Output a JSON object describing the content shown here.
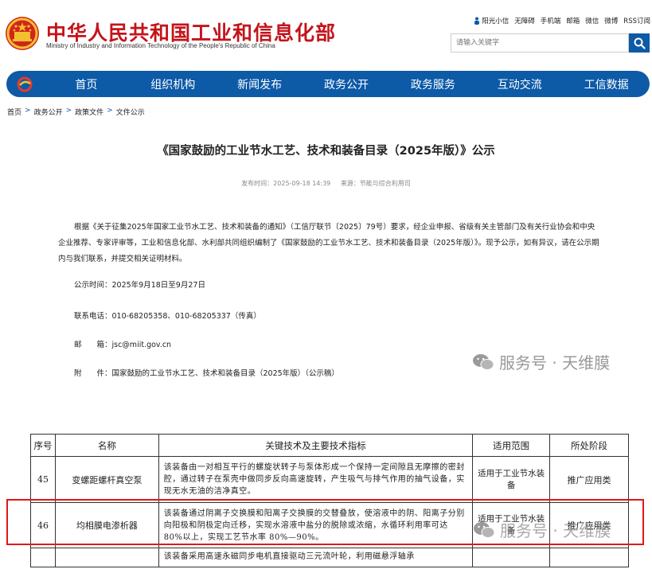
{
  "header": {
    "title": "中华人民共和国工业和信息化部",
    "subtitle": "Ministry of Industry and Information Technology of the People's Republic of China",
    "links": [
      "阳光小信",
      "无障碍",
      "手机端",
      "邮箱",
      "微信",
      "微博",
      "RSS订阅"
    ],
    "search_placeholder": "请输入关键字"
  },
  "nav": [
    "首页",
    "组织机构",
    "新闻发布",
    "政务公开",
    "政务服务",
    "互动交流",
    "工信数据"
  ],
  "breadcrumb": [
    "首页",
    "政务公开",
    "政策文件",
    "文件公示"
  ],
  "article": {
    "title": "《国家鼓励的工业节水工艺、技术和装备目录（2025年版）》公示",
    "date": "发布时间：2025-09-18 14:39",
    "source": "来源：节能与综合利用司",
    "body": "根据《关于征集2025年国家工业节水工艺、技术和装备的通知》（工信厅联节〔2025〕79号）要求，经企业申报、省级有关主管部门及有关行业协会和中央企业推荐、专家评审等，工业和信息化部、水利部共同组织编制了《国家鼓励的工业节水工艺、技术和装备目录（2025年版）》。现予公示，如有异议，请在公示期内与我们联系，并提交相关证明材料。",
    "period": "公示时间：2025年9月18日至9月27日",
    "phone": "联系电话：010-68205358、010-68205337（传真）",
    "email": "邮　　箱：jsc@miit.gov.cn",
    "attachment": "附　　件：国家鼓励的工业节水工艺、技术和装备目录（2025年版）（公示稿）"
  },
  "watermark": "服务号 · 天维膜",
  "table": {
    "headers": [
      "序号",
      "名称",
      "关键技术及主要技术指标",
      "适用范围",
      "所处阶段"
    ],
    "rows": [
      {
        "no": "45",
        "name": "变螺距螺杆真空泵",
        "desc": "该装备由一对相互平行的螺旋状转子与泵体形成一个保持一定间隙且无摩擦的密封腔，通过转子在泵壳中做同步反向高速旋转，产生吸气与排气作用的抽气设备，实现无水无油的洁净真空。",
        "scope": "适用于工业节水装备",
        "stage": "推广应用类"
      },
      {
        "no": "46",
        "name": "均相膜电渗析器",
        "desc": "该装备通过阴离子交换膜和阳离子交换膜的交替叠放，使溶液中的阴、阳离子分别向阳极和阴极定向迁移，实现水溶液中盐分的脱除或浓缩，水循环利用率可达 80%以上，实现工艺节水率 80%—90%。",
        "scope": "适用于工业节水装备",
        "stage": "推广应用类"
      },
      {
        "no": "",
        "name": "",
        "desc": "该装备采用高速永磁同步电机直接驱动三元流叶轮，利用磁悬浮轴承",
        "scope": "",
        "stage": ""
      }
    ]
  },
  "colors": {
    "brand_red": "#c4141b",
    "nav_blue": "#0d5aa7",
    "highlight_red": "#e01818"
  }
}
